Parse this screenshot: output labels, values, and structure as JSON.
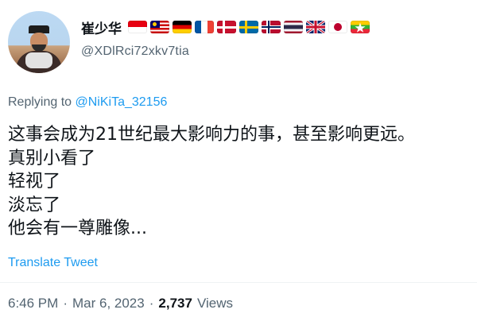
{
  "user": {
    "display_name": "崔少华",
    "handle": "@XDlRci72xkv7tia",
    "flags": [
      "Indonesia",
      "Malaysia",
      "Germany",
      "France",
      "Denmark",
      "Sweden",
      "Norway",
      "Thailand",
      "United Kingdom",
      "Japan",
      "Myanmar"
    ]
  },
  "reply": {
    "prefix": "Replying to",
    "mention": "@NiKiTa_32156"
  },
  "tweet": {
    "lines": [
      "这事会成为21世纪最大影响力的事，甚至影响更远。",
      "真别小看了",
      "轻视了",
      "淡忘了",
      "他会有一尊雕像..."
    ],
    "translate_label": "Translate Tweet"
  },
  "meta": {
    "time": "6:46 PM",
    "separator": "·",
    "date": "Mar 6, 2023",
    "views_count": "2,737",
    "views_label": "Views"
  },
  "colors": {
    "text": "#0f1419",
    "secondary": "#536471",
    "link": "#1d9bf0"
  }
}
